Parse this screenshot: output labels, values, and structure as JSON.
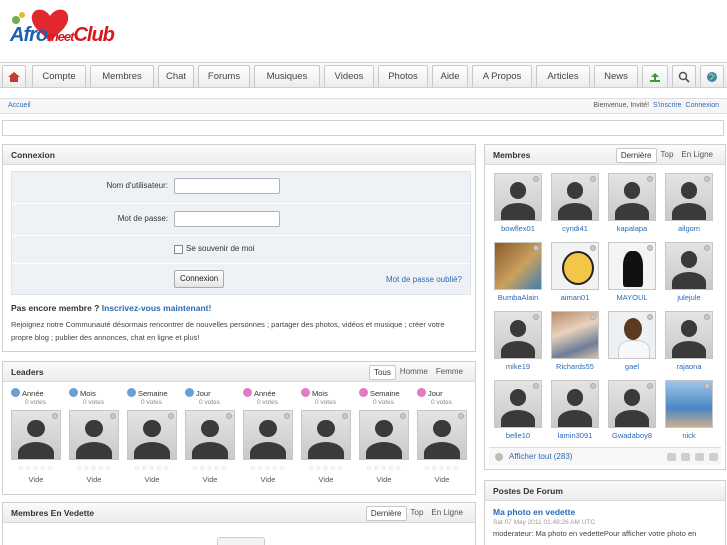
{
  "logo": {
    "text_afro": "Afro",
    "text_meet": "meet",
    "text_club": "Club"
  },
  "nav": {
    "home_icon": "home-icon",
    "tabs": [
      "Compte",
      "Membres",
      "Chat",
      "Forums",
      "Musiques",
      "Videos",
      "Photos",
      "Aide",
      "A Propos",
      "Articles",
      "News"
    ],
    "icons": [
      "upload-icon",
      "search-icon",
      "globe-icon"
    ]
  },
  "breadcrumb": {
    "home": "Accueil"
  },
  "welcome": {
    "text": "Bienvenue, Invité!",
    "signup": "S'inscrire",
    "login": "Connexion"
  },
  "login": {
    "title": "Connexion",
    "username_label": "Nom d'utilisateur:",
    "username_value": "",
    "password_label": "Mot de passe:",
    "password_value": "",
    "remember_label": "Se souvenir de moi",
    "submit_label": "Connexion",
    "forgot_label": "Mot de passe oublié?",
    "not_member": "Pas encore membre ?",
    "register_now": "Inscrivez-vous maintenant!",
    "join_text": "Rejoignez notre Communauté désormais rencontrer de nouvelles personnes ; partager des photos, vidéos et musique ; créer votre propre blog ; publier des annonces, chat en ligne et plus!"
  },
  "leaders": {
    "title": "Leaders",
    "tabs": [
      "Tous",
      "Homme",
      "Femme"
    ],
    "active_tab": "Tous",
    "periods": [
      {
        "label": "Année",
        "votes": "0 votes",
        "gender": "male"
      },
      {
        "label": "Mois",
        "votes": "0 votes",
        "gender": "male"
      },
      {
        "label": "Semaine",
        "votes": "0 votes",
        "gender": "male"
      },
      {
        "label": "Jour",
        "votes": "0 votes",
        "gender": "male"
      },
      {
        "label": "Année",
        "votes": "0 votes",
        "gender": "female"
      },
      {
        "label": "Mois",
        "votes": "0 votes",
        "gender": "female"
      },
      {
        "label": "Semaine",
        "votes": "0 votes",
        "gender": "female"
      },
      {
        "label": "Jour",
        "votes": "0 votes",
        "gender": "female"
      }
    ],
    "stars": "☆☆☆☆☆",
    "empty_label": "Vide"
  },
  "members": {
    "title": "Membres",
    "tabs": [
      "Dernière",
      "Top",
      "En Ligne"
    ],
    "active_tab": "Dernière",
    "rows": [
      [
        "bowflex01",
        "cyndi41",
        "kapalapa",
        "ailgom"
      ],
      [
        "BumbaAlain",
        "aiman01",
        "MAYOUL",
        "julejule"
      ],
      [
        "mike19",
        "Richards55",
        "gael",
        "rajaona"
      ],
      [
        "belle10",
        "lamin3091",
        "Gwadaboy8",
        "nick"
      ]
    ],
    "show_all": "Afficher tout (283)"
  },
  "forum": {
    "title": "Postes De Forum",
    "post_title": "Ma photo en vedette",
    "post_date": "Sat 07 May 2011 01:48:26 AM UTC",
    "post_excerpt": "moderateur: Ma photo en vedettePour afficher votre photo en"
  },
  "featured": {
    "title": "Membres En Vedette",
    "tabs": [
      "Dernière",
      "Top",
      "En Ligne"
    ],
    "active_tab": "Dernière"
  },
  "colors": {
    "link": "#2a6bb5",
    "brand_blue": "#1d5fb3",
    "brand_red": "#d7191c",
    "male": "#6a9fd8",
    "female": "#e777c9"
  }
}
